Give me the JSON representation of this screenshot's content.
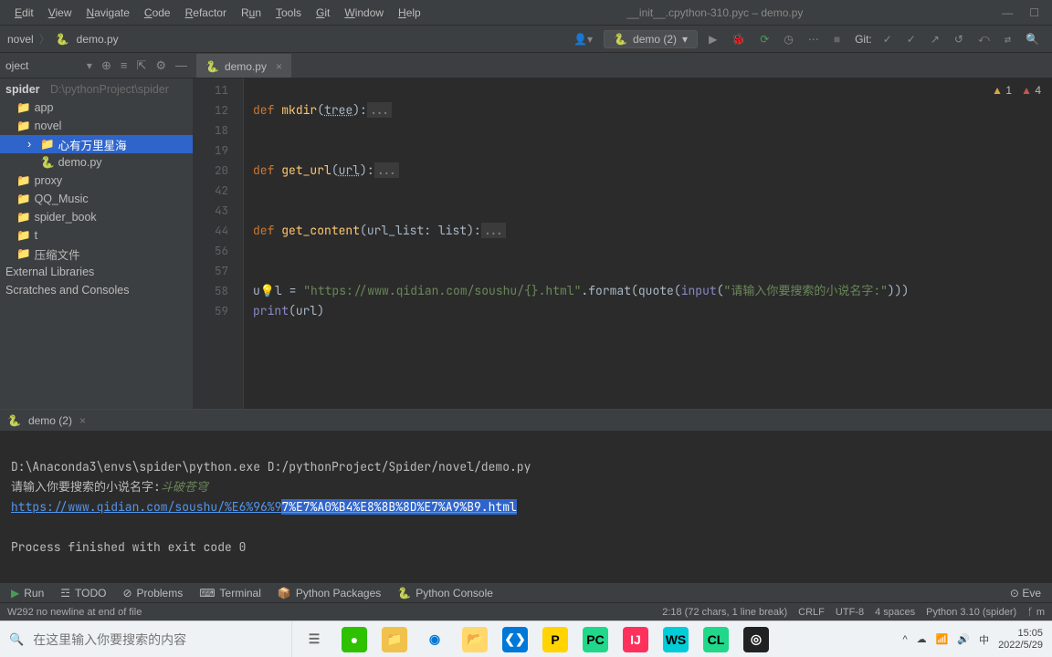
{
  "menu": [
    "Edit",
    "View",
    "Navigate",
    "Code",
    "Refactor",
    "Run",
    "Tools",
    "Git",
    "Window",
    "Help"
  ],
  "window_title": "__init__.cpython-310.pyc – demo.py",
  "breadcrumb": {
    "items": [
      "novel",
      "demo.py"
    ]
  },
  "run_config": {
    "label": "demo (2)"
  },
  "git_label": "Git:",
  "project": {
    "header": "oject",
    "root": {
      "name": "spider",
      "path": "D:\\pythonProject\\spider"
    },
    "items": [
      {
        "name": "app",
        "icon": "folder"
      },
      {
        "name": "novel",
        "icon": "folder",
        "expanded": true,
        "children": [
          {
            "name": "心有万里星海",
            "icon": "folder",
            "selected": true
          },
          {
            "name": "demo.py",
            "icon": "pyfile"
          }
        ]
      },
      {
        "name": "proxy",
        "icon": "folder-grey"
      },
      {
        "name": "QQ_Music",
        "icon": "folder-grey"
      },
      {
        "name": "spider_book",
        "icon": "folder-grey"
      },
      {
        "name": "t",
        "icon": "folder-grey"
      },
      {
        "name": "压缩文件",
        "icon": "folder-grey"
      }
    ],
    "extras": [
      "External Libraries",
      "Scratches and Consoles"
    ]
  },
  "editor": {
    "tab": "demo.py",
    "warnings": {
      "yellow": 1,
      "red": 4
    },
    "gutter": [
      "11",
      "12",
      "18",
      "19",
      "20",
      "42",
      "43",
      "44",
      "56",
      "57",
      "58",
      "59"
    ],
    "code": {
      "def": "def",
      "mkdir": "mkdir",
      "tree": "tree",
      "get_url": "get_url",
      "url": "url",
      "get_content": "get_content",
      "url_list": "url_list",
      "list": "list",
      "fold": "...",
      "assign_prefix": "u",
      "assign_rest": "l",
      "eq": " = ",
      "str_url": "\"https://www.qidian.com/soushu/{}.html\"",
      "format": "format",
      "quote": "quote",
      "input": "input",
      "prompt": "\"请输入你要搜索的小说名字:\"",
      "print": "print",
      "url_var": "url"
    }
  },
  "run": {
    "tab": "demo (2)",
    "exe": "D:\\Anaconda3\\envs\\spider\\python.exe D:/pythonProject/Spider/novel/demo.py",
    "prompt": "请输入你要搜索的小说名字:",
    "input_value": "斗破苍穹",
    "url_plain": "https://www.qidian.com/soushu/%E6%96%9",
    "url_sel": "7%E7%A0%B4%E8%8B%8D%E7%A9%B9.html",
    "exit": "Process finished with exit code 0"
  },
  "bottom": {
    "run": "Run",
    "todo": "TODO",
    "problems": "Problems",
    "terminal": "Terminal",
    "packages": "Python Packages",
    "console": "Python Console",
    "event": "Eve"
  },
  "status": {
    "left": "W292 no newline at end of file",
    "pos": "2:18 (72 chars, 1 line break)",
    "eol": "CRLF",
    "enc": "UTF-8",
    "indent": "4 spaces",
    "interp": "Python 3.10 (spider)",
    "branch": "m"
  },
  "taskbar": {
    "search_placeholder": "在这里输入你要搜索的内容",
    "time": "15:05",
    "date": "2022/5/29",
    "ime": "中"
  }
}
